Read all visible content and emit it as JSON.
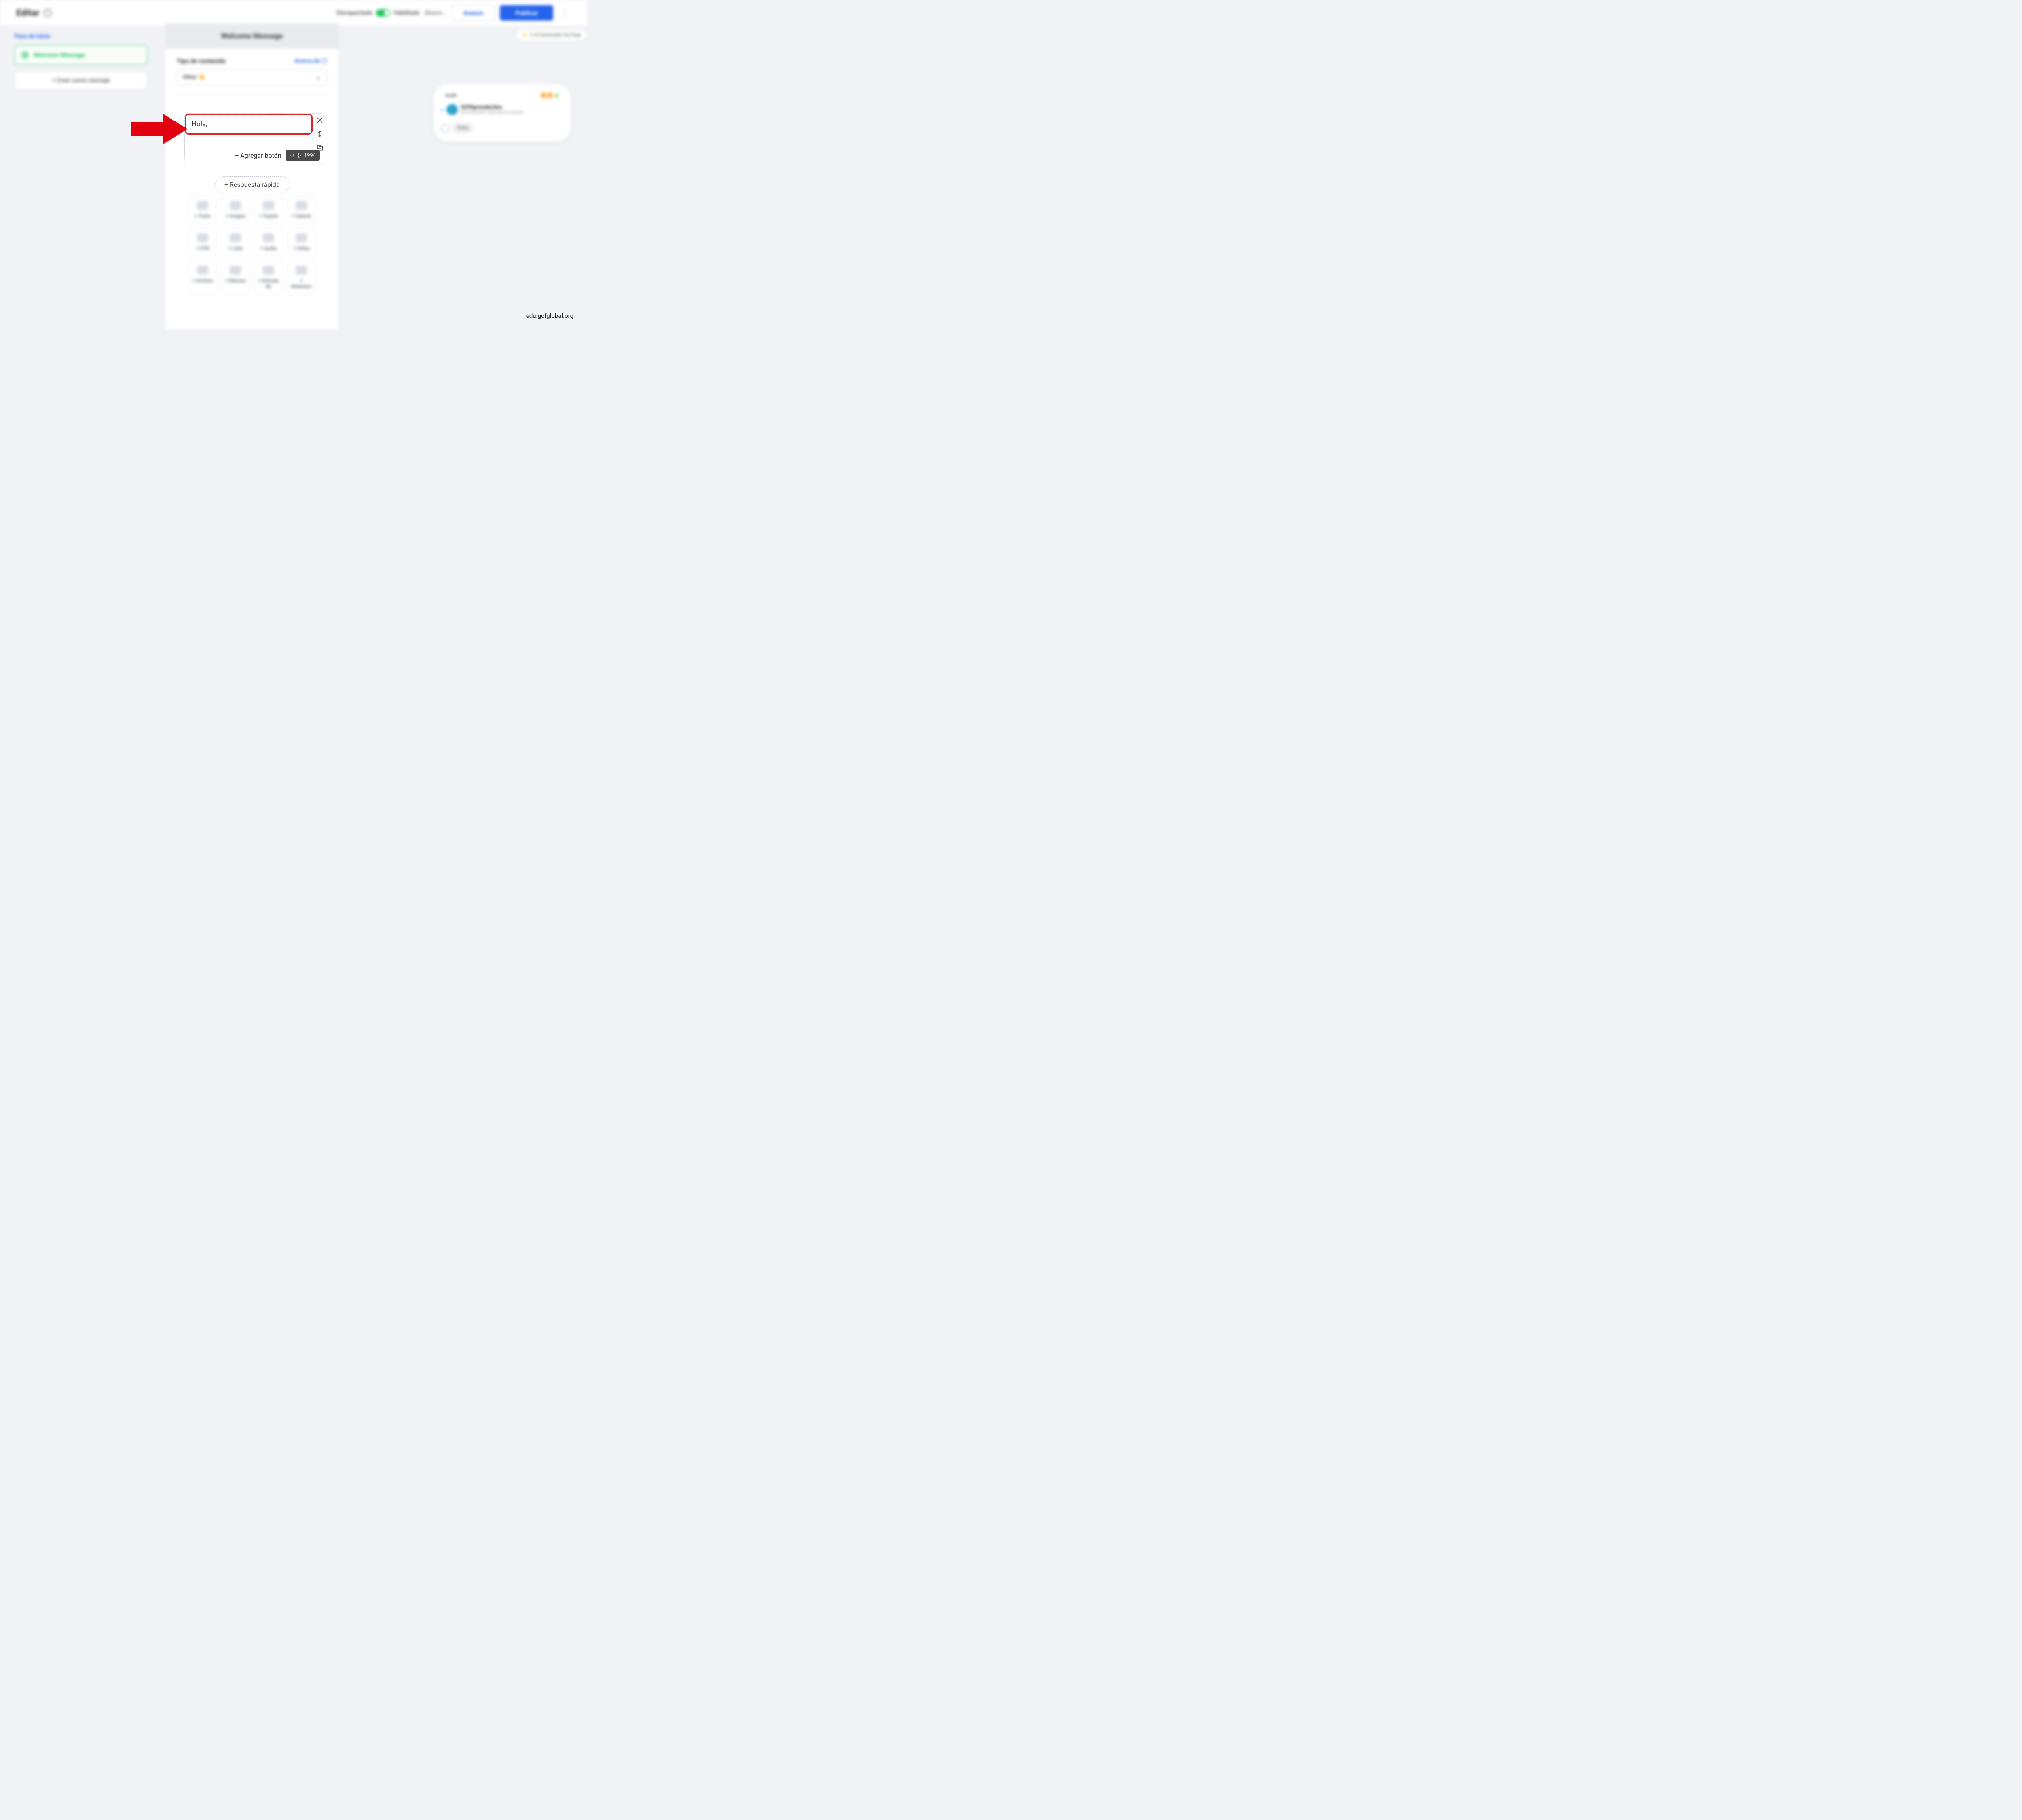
{
  "header": {
    "title": "Editar",
    "toggle_off": "Discapacitado",
    "toggle_on": "Habilitado",
    "saving": "Ahorro...",
    "advance": "Avance",
    "publish": "Publicar"
  },
  "sidebar": {
    "section_label": "Paso de inicio",
    "active_item": "Welcome Message",
    "add_button": "+ Crear nuevo mensaje"
  },
  "center": {
    "title": "Welcome Message",
    "content_type_label": "Tipo de contenido",
    "about_link": "Acerca de",
    "select_value": "Other 👋"
  },
  "compose": {
    "text_value": "Hola, ",
    "add_button_label": "+ Agregar botón",
    "char_remaining": "1994"
  },
  "quick_reply": {
    "label": "+ Respuesta rápida"
  },
  "tiles": [
    {
      "label": "+ Texto"
    },
    {
      "label": "+ Imagen"
    },
    {
      "label": "+ Tarjeta"
    },
    {
      "label": "+ Galería"
    },
    {
      "label": "+ OTN"
    },
    {
      "label": "+ Lista"
    },
    {
      "label": "+ Audio"
    },
    {
      "label": "+ Vídeo"
    },
    {
      "label": "+ Archivo"
    },
    {
      "label": "+ Retraso"
    },
    {
      "label": "+ Entrada de"
    },
    {
      "label": "+ Dinámico"
    }
  ],
  "ai_pill": "Ir Al Generador De Flujo",
  "phone": {
    "time": "16:09",
    "name": "GCFAprendeLibre",
    "sub": "Normalmente responde al instante",
    "bubble": "Hola,"
  },
  "watermark": {
    "pre": "edu.",
    "bold": "gcf",
    "post": "global.org"
  }
}
